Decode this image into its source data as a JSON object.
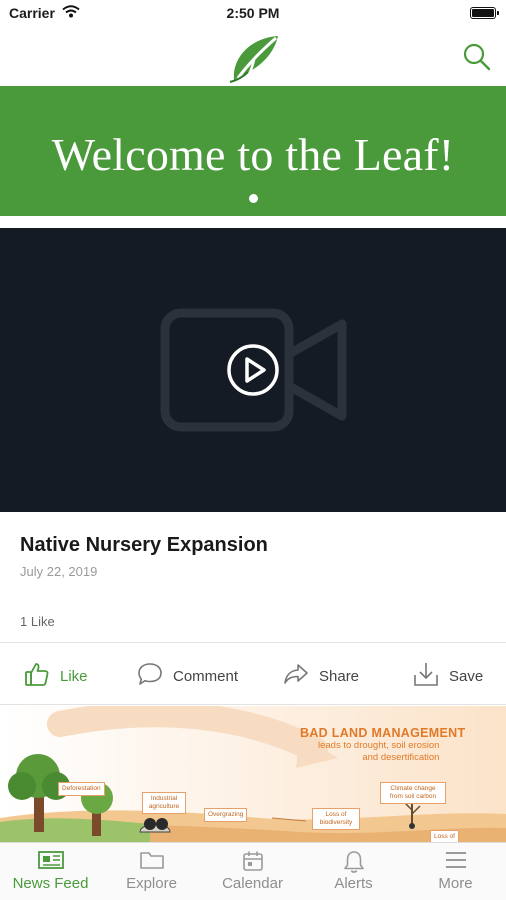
{
  "status_bar": {
    "carrier": "Carrier",
    "time": "2:50 PM"
  },
  "banner": {
    "title": "Welcome to the Leaf!"
  },
  "post": {
    "title": "Native Nursery Expansion",
    "date": "July 22, 2019",
    "likes": "1 Like"
  },
  "actions": {
    "like": "Like",
    "comment": "Comment",
    "share": "Share",
    "save": "Save"
  },
  "illustration": {
    "heading": "BAD LAND MANAGEMENT",
    "subheading_line1": "leads to drought, soil erosion",
    "subheading_line2": "and desertification",
    "labels": {
      "deforestation": "Deforestation",
      "industrial_agriculture": "Industrial agriculture",
      "overgrazing": "Overgrazing",
      "loss_of_biodiversity": "Loss of biodiversity",
      "climate_change": "Climate change from soil carbon",
      "loss_of": "Loss of"
    }
  },
  "tabs": [
    {
      "label": "News Feed",
      "icon": "newspaper-icon",
      "active": true
    },
    {
      "label": "Explore",
      "icon": "folder-icon",
      "active": false
    },
    {
      "label": "Calendar",
      "icon": "calendar-icon",
      "active": false
    },
    {
      "label": "Alerts",
      "icon": "bell-icon",
      "active": false
    },
    {
      "label": "More",
      "icon": "menu-icon",
      "active": false
    }
  ],
  "colors": {
    "brand_green": "#4a9a3c",
    "video_bg": "#151b24",
    "tab_inactive": "#8e8e8e",
    "illustration_orange": "#e07a28"
  }
}
